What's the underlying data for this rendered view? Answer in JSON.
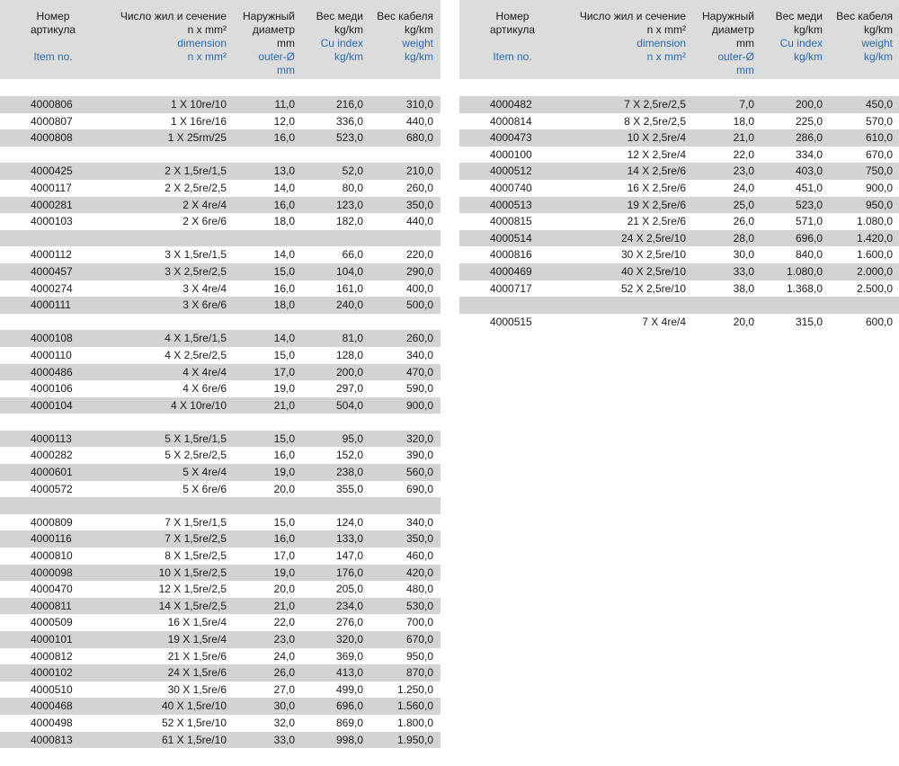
{
  "headers": {
    "col1_ru": [
      "Номер",
      "артикула"
    ],
    "col1_en": [
      "",
      "Item no."
    ],
    "col2_ru": [
      "Число жил и сечение",
      "n x mm²"
    ],
    "col2_en": [
      "dimension",
      "n x mm²"
    ],
    "col3_ru": [
      "Наружный",
      "диаметр",
      "mm"
    ],
    "col3_en": [
      "outer-Ø",
      "mm"
    ],
    "col4_ru": [
      "Вес меди",
      "kg/km"
    ],
    "col4_en": [
      "Cu index",
      "kg/km"
    ],
    "col5_ru": [
      "Вес кабеля",
      "kg/km"
    ],
    "col5_en": [
      "weight",
      "kg/km"
    ]
  },
  "left_rows": [
    {
      "item": "4000806",
      "dim": "1 X 10re/10",
      "od": "11,0",
      "cu": "216,0",
      "wt": "310,0"
    },
    {
      "item": "4000807",
      "dim": "1 X 16re/16",
      "od": "12,0",
      "cu": "336,0",
      "wt": "440,0"
    },
    {
      "item": "4000808",
      "dim": "1 X 25rm/25",
      "od": "16,0",
      "cu": "523,0",
      "wt": "680,0"
    },
    {
      "item": "",
      "dim": "",
      "od": "",
      "cu": "",
      "wt": ""
    },
    {
      "item": "4000425",
      "dim": "2 X 1,5re/1,5",
      "od": "13,0",
      "cu": "52,0",
      "wt": "210,0"
    },
    {
      "item": "4000117",
      "dim": "2 X 2,5re/2,5",
      "od": "14,0",
      "cu": "80,0",
      "wt": "260,0"
    },
    {
      "item": "4000281",
      "dim": "2 X 4re/4",
      "od": "16,0",
      "cu": "123,0",
      "wt": "350,0"
    },
    {
      "item": "4000103",
      "dim": "2 X 6re/6",
      "od": "18,0",
      "cu": "182,0",
      "wt": "440,0"
    },
    {
      "item": "",
      "dim": "",
      "od": "",
      "cu": "",
      "wt": ""
    },
    {
      "item": "4000112",
      "dim": "3 X 1,5re/1,5",
      "od": "14,0",
      "cu": "66,0",
      "wt": "220,0"
    },
    {
      "item": "4000457",
      "dim": "3 X 2,5re/2,5",
      "od": "15,0",
      "cu": "104,0",
      "wt": "290,0"
    },
    {
      "item": "4000274",
      "dim": "3 X 4re/4",
      "od": "16,0",
      "cu": "161,0",
      "wt": "400,0"
    },
    {
      "item": "4000111",
      "dim": "3 X 6re/6",
      "od": "18,0",
      "cu": "240,0",
      "wt": "500,0"
    },
    {
      "item": "",
      "dim": "",
      "od": "",
      "cu": "",
      "wt": ""
    },
    {
      "item": "4000108",
      "dim": "4 X 1,5re/1,5",
      "od": "14,0",
      "cu": "81,0",
      "wt": "260,0"
    },
    {
      "item": "4000110",
      "dim": "4 X 2,5re/2,5",
      "od": "15,0",
      "cu": "128,0",
      "wt": "340,0"
    },
    {
      "item": "4000486",
      "dim": "4 X 4re/4",
      "od": "17,0",
      "cu": "200,0",
      "wt": "470,0"
    },
    {
      "item": "4000106",
      "dim": "4 X 6re/6",
      "od": "19,0",
      "cu": "297,0",
      "wt": "590,0"
    },
    {
      "item": "4000104",
      "dim": "4 X 10re/10",
      "od": "21,0",
      "cu": "504,0",
      "wt": "900,0"
    },
    {
      "item": "",
      "dim": "",
      "od": "",
      "cu": "",
      "wt": ""
    },
    {
      "item": "4000113",
      "dim": "5 X 1,5re/1,5",
      "od": "15,0",
      "cu": "95,0",
      "wt": "320,0"
    },
    {
      "item": "4000282",
      "dim": "5 X 2,5re/2,5",
      "od": "16,0",
      "cu": "152,0",
      "wt": "390,0"
    },
    {
      "item": "4000601",
      "dim": "5 X 4re/4",
      "od": "19,0",
      "cu": "238,0",
      "wt": "560,0"
    },
    {
      "item": "4000572",
      "dim": "5 X 6re/6",
      "od": "20,0",
      "cu": "355,0",
      "wt": "690,0"
    },
    {
      "item": "",
      "dim": "",
      "od": "",
      "cu": "",
      "wt": ""
    },
    {
      "item": "4000809",
      "dim": "7 X 1,5re/1,5",
      "od": "15,0",
      "cu": "124,0",
      "wt": "340,0"
    },
    {
      "item": "4000116",
      "dim": "7 X 1,5re/2,5",
      "od": "16,0",
      "cu": "133,0",
      "wt": "350,0"
    },
    {
      "item": "4000810",
      "dim": "8 X 1,5re/2,5",
      "od": "17,0",
      "cu": "147,0",
      "wt": "460,0"
    },
    {
      "item": "4000098",
      "dim": "10 X 1,5re/2,5",
      "od": "19,0",
      "cu": "176,0",
      "wt": "420,0"
    },
    {
      "item": "4000470",
      "dim": "12 X 1,5re/2,5",
      "od": "20,0",
      "cu": "205,0",
      "wt": "480,0"
    },
    {
      "item": "4000811",
      "dim": "14 X 1,5re/2,5",
      "od": "21,0",
      "cu": "234,0",
      "wt": "530,0"
    },
    {
      "item": "4000509",
      "dim": "16 X 1,5re/4",
      "od": "22,0",
      "cu": "276,0",
      "wt": "700,0"
    },
    {
      "item": "4000101",
      "dim": "19 X 1,5re/4",
      "od": "23,0",
      "cu": "320,0",
      "wt": "670,0"
    },
    {
      "item": "4000812",
      "dim": "21 X 1,5re/6",
      "od": "24,0",
      "cu": "369,0",
      "wt": "950,0"
    },
    {
      "item": "4000102",
      "dim": "24 X 1,5re/6",
      "od": "26,0",
      "cu": "413,0",
      "wt": "870,0"
    },
    {
      "item": "4000510",
      "dim": "30 X 1,5re/6",
      "od": "27,0",
      "cu": "499,0",
      "wt": "1.250,0"
    },
    {
      "item": "4000468",
      "dim": "40 X 1,5re/10",
      "od": "30,0",
      "cu": "696,0",
      "wt": "1.560,0"
    },
    {
      "item": "4000498",
      "dim": "52 X 1,5re/10",
      "od": "32,0",
      "cu": "869,0",
      "wt": "1.800,0"
    },
    {
      "item": "4000813",
      "dim": "61 X 1,5re/10",
      "od": "33,0",
      "cu": "998,0",
      "wt": "1.950,0"
    }
  ],
  "right_rows": [
    {
      "item": "4000482",
      "dim": "7 X 2,5re/2,5",
      "od": "7,0",
      "cu": "200,0",
      "wt": "450,0"
    },
    {
      "item": "4000814",
      "dim": "8 X 2,5re/2,5",
      "od": "18,0",
      "cu": "225,0",
      "wt": "570,0"
    },
    {
      "item": "4000473",
      "dim": "10 X 2,5re/4",
      "od": "21,0",
      "cu": "286,0",
      "wt": "610,0"
    },
    {
      "item": "4000100",
      "dim": "12 X 2,5re/4",
      "od": "22,0",
      "cu": "334,0",
      "wt": "670,0"
    },
    {
      "item": "4000512",
      "dim": "14 X 2,5re/6",
      "od": "23,0",
      "cu": "403,0",
      "wt": "750,0"
    },
    {
      "item": "4000740",
      "dim": "16 X 2,5re/6",
      "od": "24,0",
      "cu": "451,0",
      "wt": "900,0"
    },
    {
      "item": "4000513",
      "dim": "19 X 2,5re/6",
      "od": "25,0",
      "cu": "523,0",
      "wt": "950,0"
    },
    {
      "item": "4000815",
      "dim": "21 X 2,5re/6",
      "od": "26,0",
      "cu": "571,0",
      "wt": "1.080,0"
    },
    {
      "item": "4000514",
      "dim": "24 X 2,5re/10",
      "od": "28,0",
      "cu": "696,0",
      "wt": "1.420,0"
    },
    {
      "item": "4000816",
      "dim": "30 X 2,5re/10",
      "od": "30,0",
      "cu": "840,0",
      "wt": "1.600,0"
    },
    {
      "item": "4000469",
      "dim": "40 X 2,5re/10",
      "od": "33,0",
      "cu": "1.080,0",
      "wt": "2.000,0"
    },
    {
      "item": "4000717",
      "dim": "52 X 2,5re/10",
      "od": "38,0",
      "cu": "1.368,0",
      "wt": "2.500,0"
    },
    {
      "item": "",
      "dim": "",
      "od": "",
      "cu": "",
      "wt": ""
    },
    {
      "item": "4000515",
      "dim": "7 X 4re/4",
      "od": "20,0",
      "cu": "315,0",
      "wt": "600,0"
    }
  ]
}
